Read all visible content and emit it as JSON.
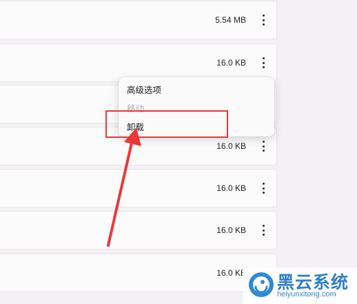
{
  "rows": [
    {
      "size": "5.54 MB"
    },
    {
      "size": "16.0 KB"
    },
    {
      "size": ""
    },
    {
      "size": "16.0 KB"
    },
    {
      "size": "16.0 KB"
    },
    {
      "size": "16.0 KB"
    },
    {
      "size": "16.0 KB"
    }
  ],
  "context_menu": {
    "items": [
      {
        "label": "高级选项",
        "enabled": true
      },
      {
        "label": "移动",
        "enabled": false
      },
      {
        "label": "卸载",
        "enabled": true
      }
    ]
  },
  "annotation": {
    "color": "#e8383a"
  },
  "watermark": {
    "title": "黑云系统",
    "subtitle": "heiyunxitong.com"
  }
}
